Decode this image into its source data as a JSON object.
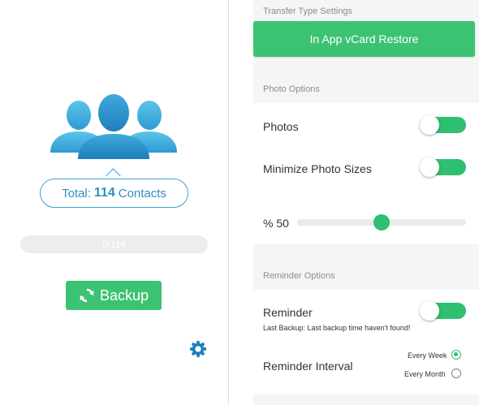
{
  "left": {
    "total_prefix": "Total:",
    "total_count": "114",
    "total_suffix": "Contacts",
    "progress": {
      "text": "0/114",
      "fraction": 0.0
    },
    "backup_label": "Backup"
  },
  "right": {
    "transfer": {
      "header": "Transfer Type Settings",
      "button": "In App vCard Restore"
    },
    "photo": {
      "header": "Photo Options",
      "photos_label": "Photos",
      "photos_on": true,
      "minimize_label": "Minimize Photo Sizes",
      "minimize_on": true,
      "slider_label": "% 50",
      "slider_value": 0.5
    },
    "reminder": {
      "header": "Reminder Options",
      "reminder_label": "Reminder",
      "reminder_on": true,
      "last_backup": "Last Backup: Last backup time haven't found!",
      "interval_label": "Reminder Interval",
      "options": [
        {
          "label": "Every Week",
          "selected": true
        },
        {
          "label": "Every Month",
          "selected": false
        }
      ]
    }
  },
  "colors": {
    "accent": "#2fbf71",
    "button": "#3cc273",
    "contact_blue": "#2e8fc4"
  },
  "icons": {
    "contacts": "people-group-icon",
    "backup": "sync-icon",
    "settings": "gear-icon"
  }
}
